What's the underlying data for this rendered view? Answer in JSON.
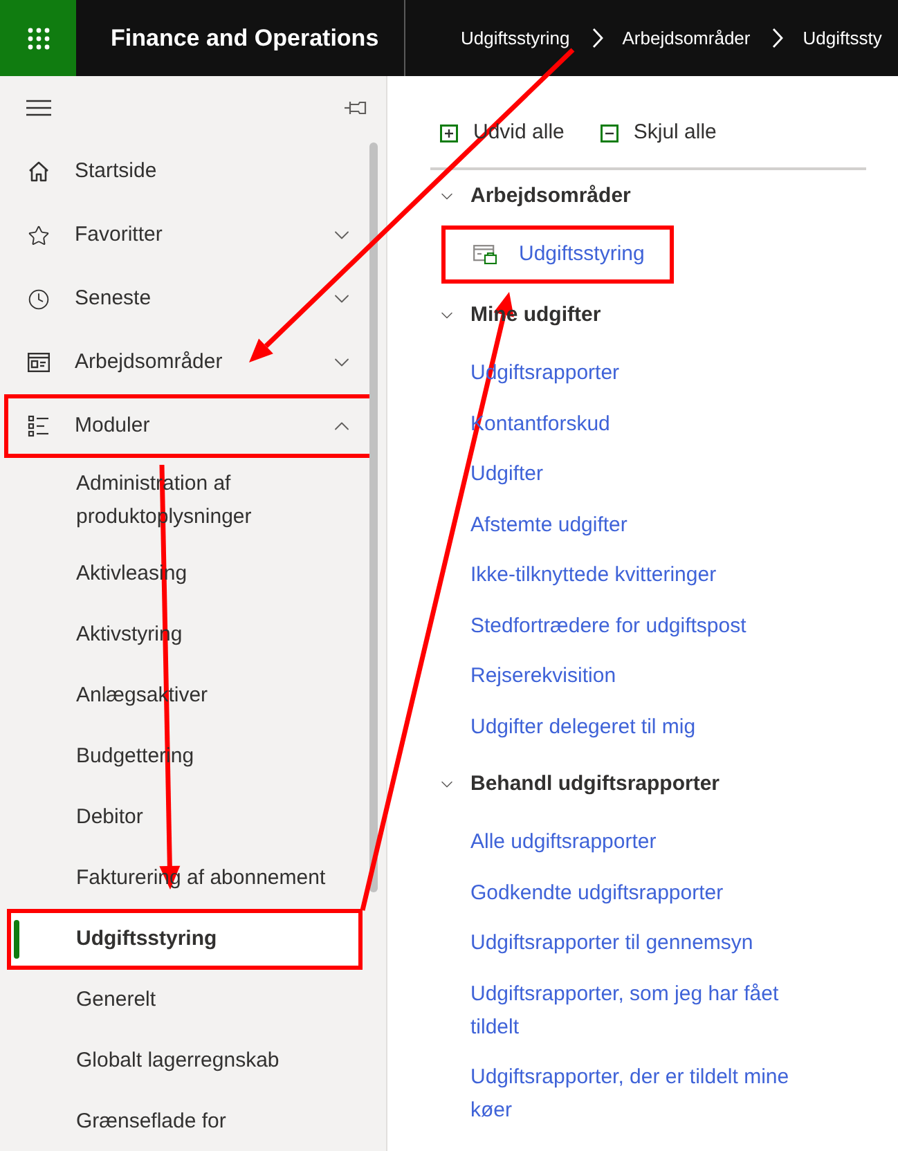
{
  "app_bar": {
    "title": "Finance and Operations",
    "breadcrumbs": [
      "Udgiftsstyring",
      "Arbejdsområder",
      "Udgiftssty"
    ]
  },
  "nav": {
    "items": [
      {
        "label": "Startside",
        "highlighted": false
      },
      {
        "label": "Favoritter",
        "expanded": false,
        "highlighted": false
      },
      {
        "label": "Seneste",
        "expanded": false,
        "highlighted": false
      },
      {
        "label": "Arbejdsområder",
        "expanded": false,
        "highlighted": false
      },
      {
        "label": "Moduler",
        "expanded": true,
        "highlighted": true,
        "children": [
          {
            "label": "Administration af produktoplysninger",
            "selected": false,
            "highlighted": false
          },
          {
            "label": "Aktivleasing",
            "selected": false,
            "highlighted": false
          },
          {
            "label": "Aktivstyring",
            "selected": false,
            "highlighted": false
          },
          {
            "label": "Anlægsaktiver",
            "selected": false,
            "highlighted": false
          },
          {
            "label": "Budgettering",
            "selected": false,
            "highlighted": false
          },
          {
            "label": "Debitor",
            "selected": false,
            "highlighted": false
          },
          {
            "label": "Fakturering af abonnement",
            "selected": false,
            "highlighted": false
          },
          {
            "label": "Udgiftsstyring",
            "selected": true,
            "highlighted": true
          },
          {
            "label": "Generelt",
            "selected": false,
            "highlighted": false
          },
          {
            "label": "Globalt lagerregnskab",
            "selected": false,
            "highlighted": false
          },
          {
            "label": "Grænseflade for",
            "selected": false,
            "highlighted": false
          }
        ]
      }
    ]
  },
  "toolbar": [
    "Udvid alle",
    "Skjul alle"
  ],
  "sections": [
    {
      "title": "Arbejdsområder",
      "expanded": true,
      "kind": "tiles",
      "links": [
        {
          "label": "Udgiftsstyring",
          "highlighted": true
        }
      ]
    },
    {
      "title": "Mine udgifter",
      "expanded": true,
      "kind": "links",
      "links": [
        {
          "label": "Udgiftsrapporter",
          "highlighted": false
        },
        {
          "label": "Kontantforskud",
          "highlighted": false
        },
        {
          "label": "Udgifter",
          "highlighted": false
        },
        {
          "label": "Afstemte udgifter",
          "highlighted": false
        },
        {
          "label": "Ikke-tilknyttede kvitteringer",
          "highlighted": false
        },
        {
          "label": "Stedfortrædere for udgiftspost",
          "highlighted": false
        },
        {
          "label": "Rejserekvisition",
          "highlighted": false
        },
        {
          "label": "Udgifter delegeret til mig",
          "highlighted": false
        }
      ]
    },
    {
      "title": "Behandl udgiftsrapporter",
      "expanded": true,
      "kind": "links",
      "links": [
        {
          "label": "Alle udgiftsrapporter",
          "highlighted": false
        },
        {
          "label": "Godkendte udgiftsrapporter",
          "highlighted": false
        },
        {
          "label": "Udgiftsrapporter til gennemsyn",
          "highlighted": false
        },
        {
          "label": "Udgiftsrapporter, som jeg har fået tildelt",
          "highlighted": false
        },
        {
          "label": "Udgiftsrapporter, der er tildelt mine køer",
          "highlighted": false
        }
      ]
    }
  ]
}
